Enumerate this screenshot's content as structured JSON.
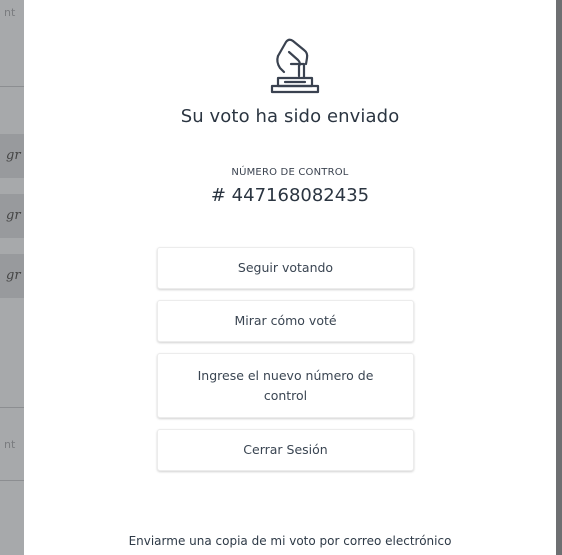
{
  "modal": {
    "icon": "ballot-box-hand-icon",
    "title": "Su voto ha sido enviado",
    "control_label": "NÚMERO DE CONTROL",
    "control_number": "# 447168082435",
    "buttons": [
      {
        "label": "Seguir votando"
      },
      {
        "label": "Mirar cómo voté"
      },
      {
        "label": "Ingrese el nuevo número de control"
      },
      {
        "label": "Cerrar Sesión"
      }
    ],
    "email_link": "Enviarme una copia de mi voto por correo electrónico"
  },
  "background": {
    "fragments": [
      "nt",
      "gr",
      "gr",
      "gr",
      "nt"
    ]
  },
  "colors": {
    "modal_bg": "#ffffff",
    "overlay": "#6f7073",
    "text": "#2b3541"
  }
}
